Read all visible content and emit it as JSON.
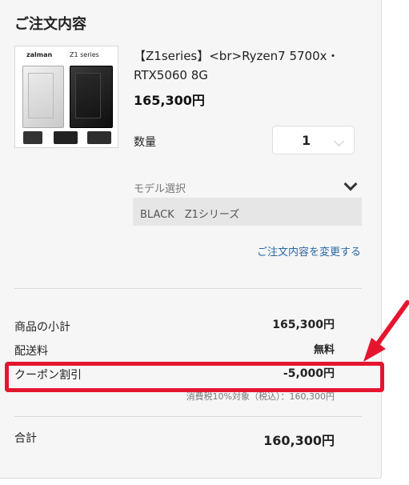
{
  "order": {
    "title": "ご注文内容",
    "product": {
      "thumbnail_brand_left": "zalman",
      "thumbnail_brand_right": "Z1 series",
      "name": "【Z1series】<br>Ryzen7 5700x・RTX5060 8G",
      "price": "165,300円"
    },
    "quantity": {
      "label": "数量",
      "value": "1"
    },
    "model": {
      "label": "モデル選択",
      "value": "BLACK　Z1シリーズ"
    },
    "change_link": "ご注文内容を変更する"
  },
  "summary": {
    "subtotal_label": "商品の小計",
    "subtotal_value": "165,300円",
    "shipping_label": "配送料",
    "shipping_value": "無料",
    "coupon_label": "クーポン割引",
    "coupon_value": "-5,000円",
    "tax_note": "消費税10%対象（税込）：160,300円",
    "total_label": "合計",
    "total_value": "160,300円"
  },
  "annotation": {
    "highlight_color": "#e4162f"
  }
}
